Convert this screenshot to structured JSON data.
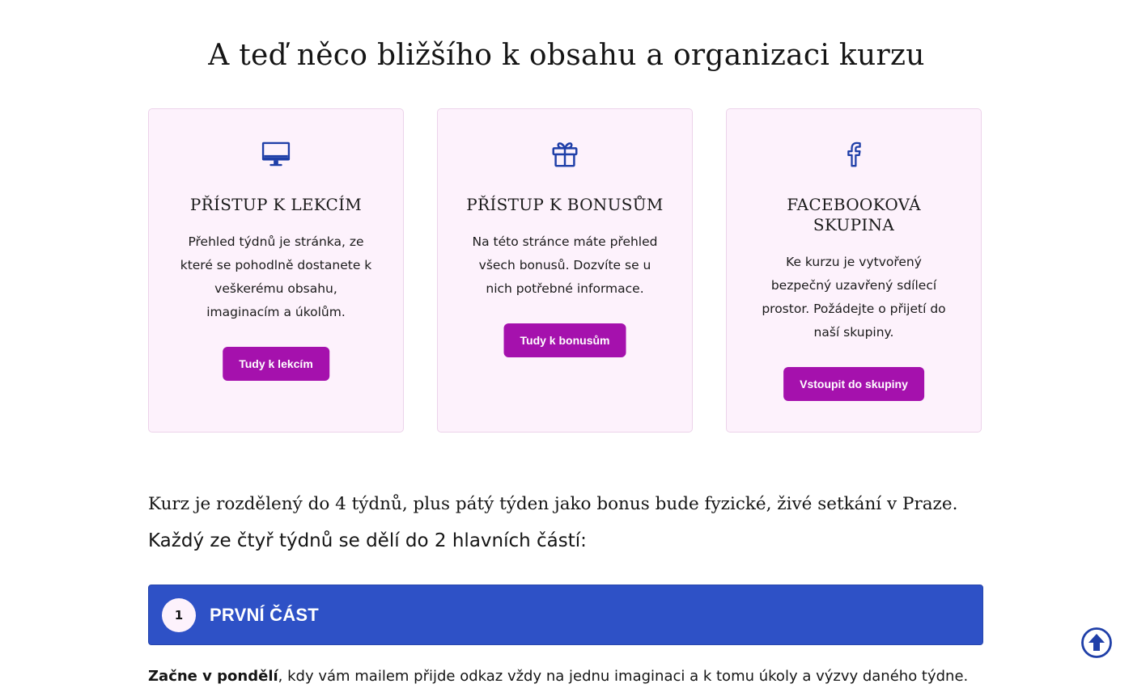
{
  "page": {
    "title": "A teď něco bližšího k obsahu a organizaci kurzu"
  },
  "cards": [
    {
      "icon": "monitor-icon",
      "title": "PŘÍSTUP K LEKCÍM",
      "text": "Přehled týdnů je stránka, ze které se pohodlně dostanete k veškerému obsahu, imaginacím a úkolům.",
      "button_label": "Tudy k lekcím"
    },
    {
      "icon": "gift-icon",
      "title": "PŘÍSTUP K BONUSŮM",
      "text": "Na této stránce máte přehled všech bonusů. Dozvíte se u nich potřebné informace.",
      "button_label": "Tudy k bonusům"
    },
    {
      "icon": "facebook-icon",
      "title": "FACEBOOKOVÁ SKUPINA",
      "text": "Ke kurzu je vytvořený bezpečný uzavřený sdílecí prostor. Požádejte o přijetí do naší skupiny.",
      "button_label": "Vstoupit do skupiny"
    }
  ],
  "intro": {
    "line1": "Kurz je rozdělený do 4 týdnů, plus pátý týden jako bonus bude fyzické, živé setkání v Praze.",
    "line2": "Každý ze čtyř týdnů se dělí do 2 hlavních částí:"
  },
  "accordion": {
    "number": "1",
    "title": "PRVNÍ ČÁST"
  },
  "bottom": {
    "bold": "Začne v pondělí",
    "rest": ", kdy vám mailem přijde odkaz vždy na jednu imaginaci a k tomu úkoly a výzvy daného týdne."
  },
  "scroll_top": {
    "icon": "arrow-up-circle-icon"
  },
  "colors": {
    "button": "#a511ad",
    "card_bg": "#fdf2fc",
    "icon": "#1f3fa8",
    "accordion": "#2e51c6"
  }
}
